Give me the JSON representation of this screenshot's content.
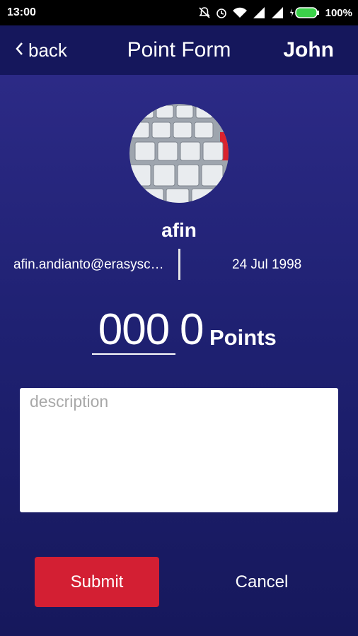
{
  "status_bar": {
    "time": "13:00",
    "battery": "100%"
  },
  "app_bar": {
    "back_label": "back",
    "title": "Point Form",
    "user": "John"
  },
  "profile": {
    "name": "afin",
    "email": "afin.andianto@erasysconsulting.com",
    "dob": "24 Jul 1998"
  },
  "points": {
    "input_value": "000",
    "value": "0",
    "label": "Points"
  },
  "description": {
    "placeholder": "description",
    "value": ""
  },
  "actions": {
    "submit_label": "Submit",
    "cancel_label": "Cancel"
  },
  "colors": {
    "appbar": "#15175c",
    "accent": "#d31f33",
    "background_top": "#2c2a86",
    "background_bottom": "#16185c"
  }
}
